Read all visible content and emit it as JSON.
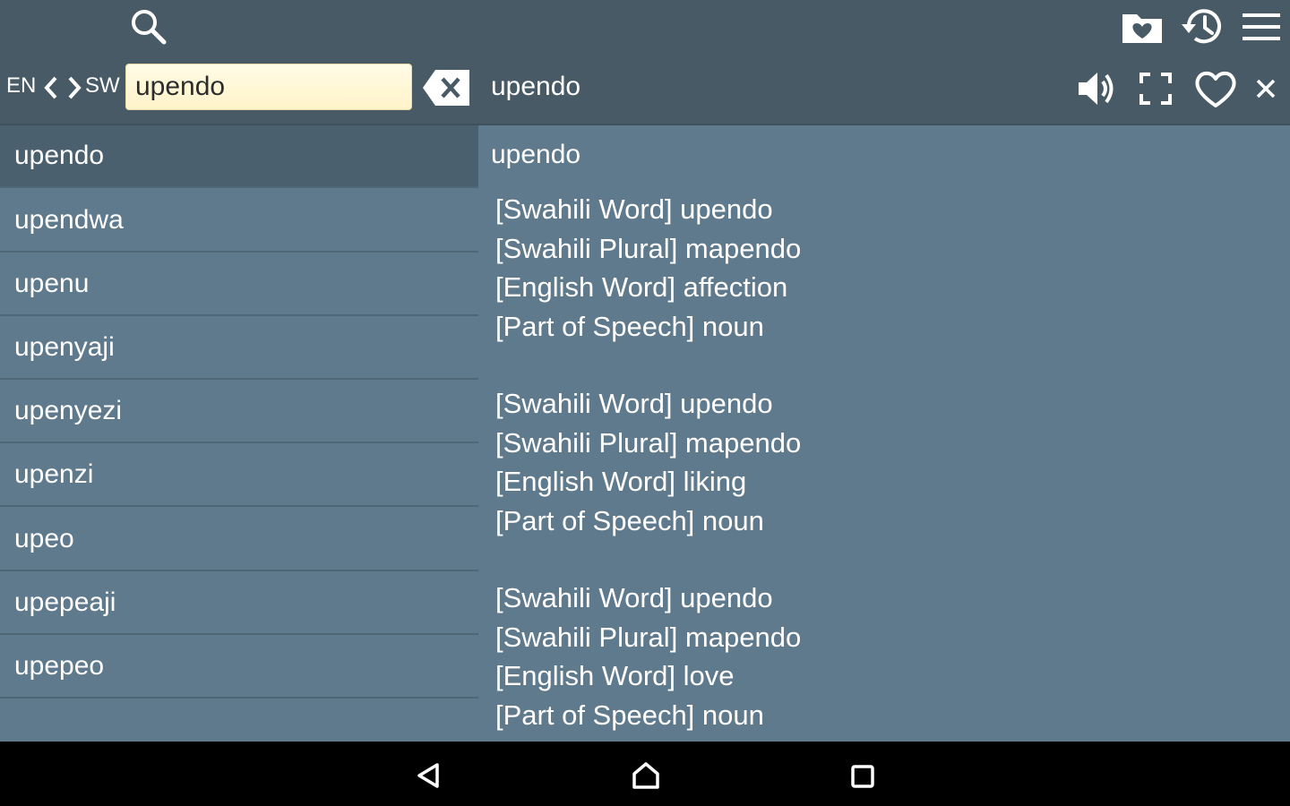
{
  "toolbar": {
    "icons": [
      "search-icon",
      "favorites-folder-icon",
      "history-icon",
      "menu-icon"
    ]
  },
  "search": {
    "lang_from": "EN",
    "lang_to": "SW",
    "query": "upendo",
    "placeholder": ""
  },
  "header": {
    "word": "upendo",
    "icons": [
      "speaker-icon",
      "fullscreen-icon",
      "heart-icon",
      "close-icon"
    ]
  },
  "word_list": {
    "selected_index": 0,
    "items": [
      "upendo",
      "upendwa",
      "upenu",
      "upenyaji",
      "upenyezi",
      "upenzi",
      "upeo",
      "upepeaji",
      "upepeo"
    ]
  },
  "detail": {
    "title": "upendo",
    "entries": [
      {
        "swahili_word": "[Swahili Word] upendo",
        "swahili_plural": "[Swahili Plural] mapendo",
        "english_word": "[English Word] affection",
        "part_of_speech": "[Part of Speech] noun"
      },
      {
        "swahili_word": "[Swahili Word] upendo",
        "swahili_plural": "[Swahili Plural] mapendo",
        "english_word": "[English Word] liking",
        "part_of_speech": "[Part of Speech] noun"
      },
      {
        "swahili_word": "[Swahili Word] upendo",
        "swahili_plural": "[Swahili Plural] mapendo",
        "english_word": "[English Word] love",
        "part_of_speech": "[Part of Speech] noun"
      }
    ]
  },
  "colors": {
    "toolbar_bg": "#475a66",
    "content_bg": "#5f7a8c",
    "selected_bg": "#4b606e",
    "search_field_bg": "#fff6d6",
    "navbar_bg": "#000000"
  },
  "navbar": {
    "icons": [
      "back-icon",
      "home-icon",
      "recents-icon"
    ]
  }
}
